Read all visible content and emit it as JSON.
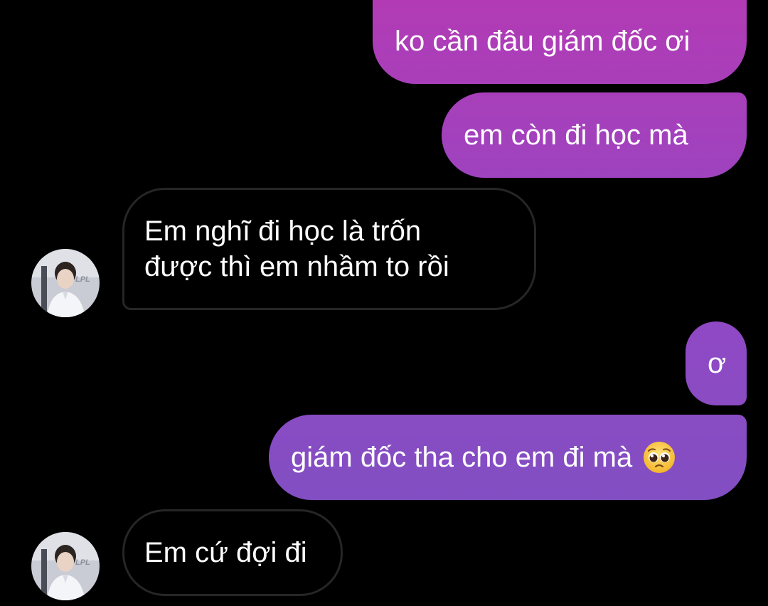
{
  "conversation": {
    "messages": [
      {
        "direction": "sent",
        "text": "ko cần đâu giám đốc ơi"
      },
      {
        "direction": "sent",
        "text": "em còn đi học mà"
      },
      {
        "direction": "received",
        "lines": [
          "Em nghĩ đi học là trốn",
          "được thì em nhầm to rồi"
        ]
      },
      {
        "direction": "sent",
        "text": "ơ"
      },
      {
        "direction": "sent",
        "text": "giám đốc tha cho em đi mà",
        "emoji": "pleading-face-icon"
      },
      {
        "direction": "received",
        "text": "Em cứ đợi đi"
      }
    ],
    "avatar_logo_text": "LPL"
  },
  "colors": {
    "background": "#000000",
    "sent_gradient_top": "#b23bb5",
    "sent_gradient_bottom": "#7a52c2",
    "received_border": "#262626",
    "text": "#ffffff"
  }
}
